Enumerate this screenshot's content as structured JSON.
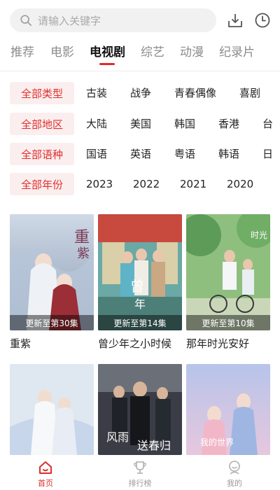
{
  "search": {
    "placeholder": "请输入关键字"
  },
  "tabs": [
    {
      "label": "推荐"
    },
    {
      "label": "电影"
    },
    {
      "label": "电视剧",
      "active": true
    },
    {
      "label": "综艺"
    },
    {
      "label": "动漫"
    },
    {
      "label": "纪录片"
    }
  ],
  "filters": [
    {
      "all": "全部类型",
      "options": [
        "古装",
        "战争",
        "青春偶像",
        "喜剧"
      ]
    },
    {
      "all": "全部地区",
      "options": [
        "大陆",
        "美国",
        "韩国",
        "香港",
        "台"
      ]
    },
    {
      "all": "全部语种",
      "options": [
        "国语",
        "英语",
        "粤语",
        "韩语",
        "日"
      ]
    },
    {
      "all": "全部年份",
      "options": [
        "2023",
        "2022",
        "2021",
        "2020"
      ]
    }
  ],
  "shows": [
    {
      "title": "重紫",
      "badge": "更新至第30集"
    },
    {
      "title": "曾少年之小时候",
      "badge": "更新至第14集"
    },
    {
      "title": "那年时光安好",
      "badge": "更新至第10集"
    },
    {
      "title": "",
      "badge": ""
    },
    {
      "title": "",
      "badge": ""
    },
    {
      "title": "",
      "badge": ""
    }
  ],
  "bottom_nav": [
    {
      "label": "首页",
      "icon": "home-icon",
      "active": true
    },
    {
      "label": "排行榜",
      "icon": "trophy-icon"
    },
    {
      "label": "我的",
      "icon": "profile-icon"
    }
  ],
  "colors": {
    "accent": "#e0302f",
    "pill_bg": "#fbeeee"
  }
}
